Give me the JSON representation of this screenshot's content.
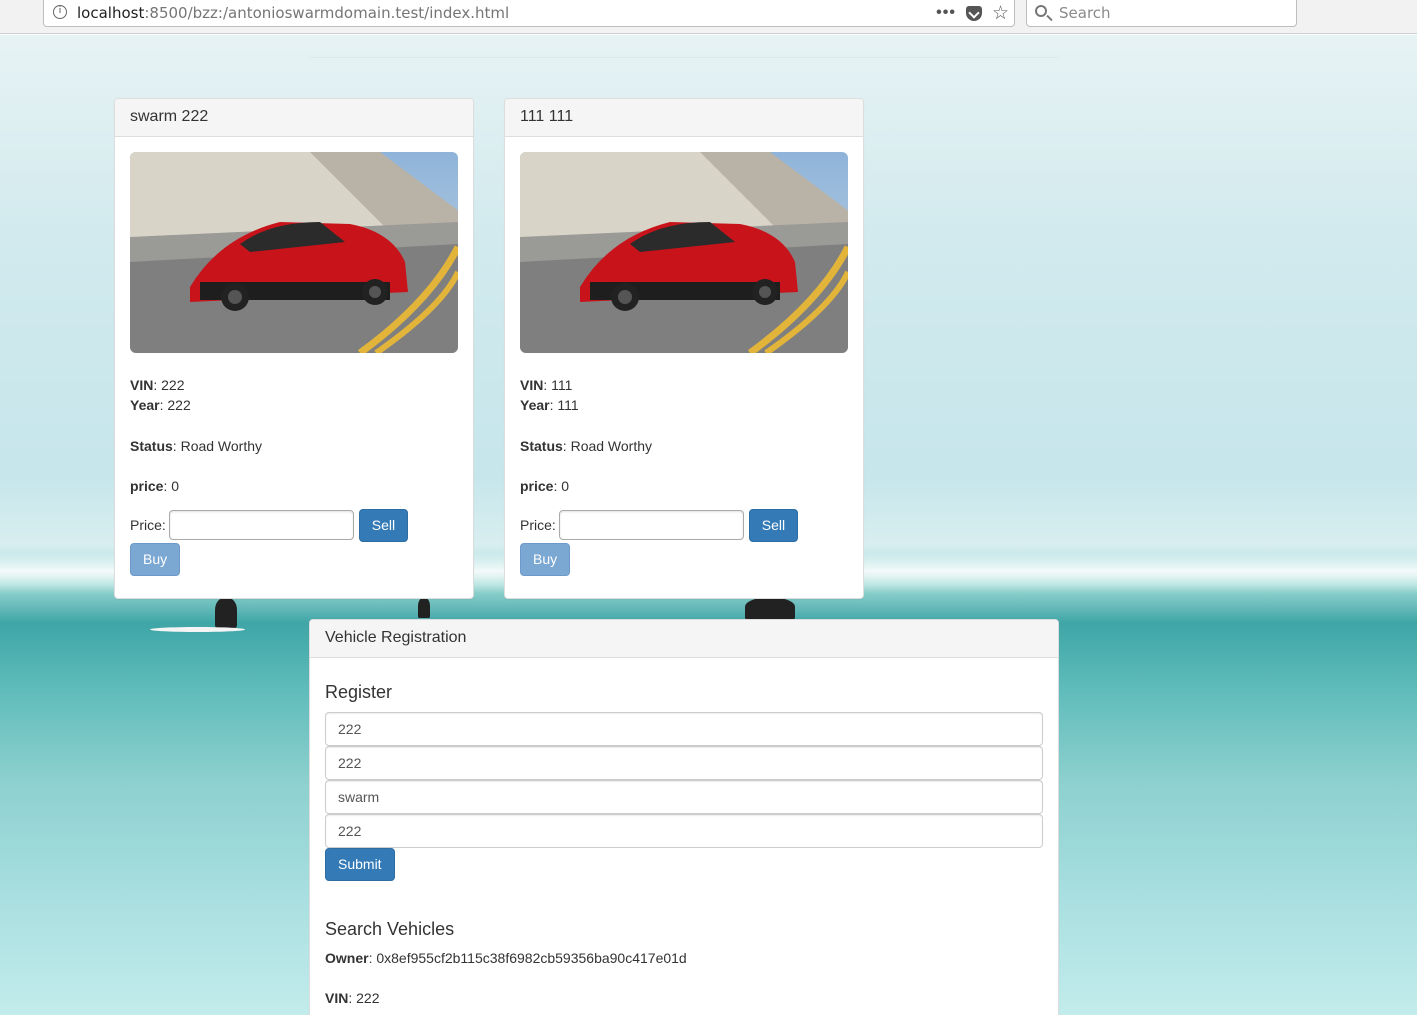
{
  "browser": {
    "url_host": "localhost",
    "url_rest": ":8500/bzz:/antonioswarmdomain.test/index.html",
    "search_placeholder": "Search",
    "more_label": "•••"
  },
  "vehicles": [
    {
      "title": "swarm 222",
      "vin_label": "VIN",
      "vin": "222",
      "year_label": "Year",
      "year": "222",
      "status_label": "Status",
      "status": "Road Worthy",
      "price_label": "price",
      "price": "0",
      "price_input_label": "Price:",
      "sell_label": "Sell",
      "buy_label": "Buy"
    },
    {
      "title": "111 111",
      "vin_label": "VIN",
      "vin": "111",
      "year_label": "Year",
      "year": "111",
      "status_label": "Status",
      "status": "Road Worthy",
      "price_label": "price",
      "price": "0",
      "price_input_label": "Price:",
      "sell_label": "Sell",
      "buy_label": "Buy"
    }
  ],
  "registration": {
    "panel_title": "Vehicle Registration",
    "register_heading": "Register",
    "fields": [
      "222",
      "222",
      "swarm",
      "222"
    ],
    "submit_label": "Submit",
    "search_heading": "Search Vehicles",
    "owner_label": "Owner",
    "owner": "0x8ef955cf2b115c38f6982cb59356ba90c417e01d",
    "vin_label": "VIN",
    "vin": "222"
  }
}
